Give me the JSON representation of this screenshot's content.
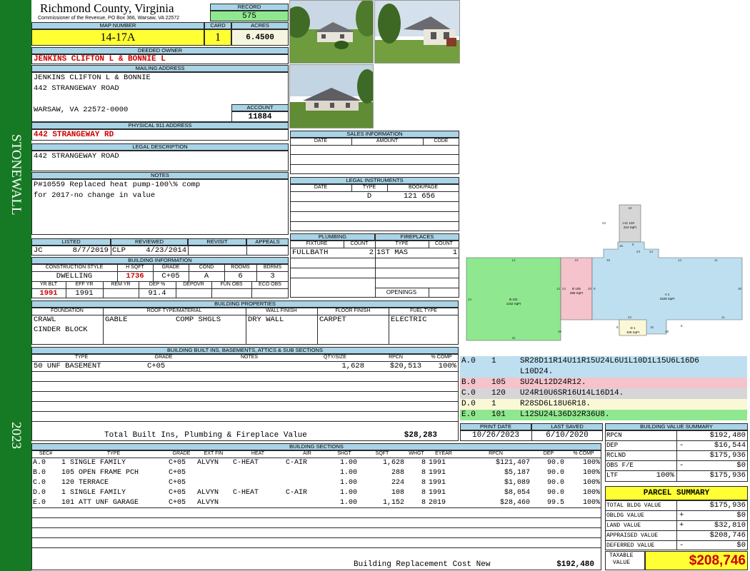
{
  "sidebar": {
    "district": "STONEWALL",
    "year": "2023"
  },
  "header": {
    "county": "Richmond County, Virginia",
    "commissioner": "Commissioner of the Revenue, PO Box 366, Warsaw, VA 22572"
  },
  "record": {
    "label": "RECORD",
    "value": "575"
  },
  "map": {
    "label": "MAP NUMBER",
    "value": "14-17A"
  },
  "card": {
    "label": "CARD",
    "value": "1"
  },
  "acres": {
    "label": "ACRES",
    "value": "6.4500"
  },
  "owner": {
    "label": "DEEDED OWNER",
    "value": "JENKINS CLIFTON L & BONNIE L"
  },
  "mailing": {
    "label": "MAILING ADDRESS",
    "line1": "JENKINS CLIFTON L & BONNIE",
    "line2": "442 STRANGEWAY ROAD",
    "line3": "WARSAW, VA 22572-0000"
  },
  "account": {
    "label": "ACCOUNT",
    "value": "11884"
  },
  "physical": {
    "label": "PHYSICAL 911 ADDRESS",
    "value": "442 STRANGEWAY RD"
  },
  "legal": {
    "label": "LEGAL DESCRIPTION",
    "value": "442 STRANGEWAY ROAD"
  },
  "notes": {
    "label": "NOTES",
    "line1": "P#10559 Replaced heat pump-100\\% comp",
    "line2": "for 2017-no change in value"
  },
  "sales": {
    "label": "SALES INFORMATION",
    "cols": [
      "DATE",
      "AMOUNT",
      "CODE"
    ]
  },
  "instruments": {
    "label": "LEGAL INSTRUMENTS",
    "cols": [
      "DATE",
      "TYPE",
      "BOOK/PAGE"
    ],
    "type": "D",
    "bookpage": "121 656"
  },
  "plumbing": {
    "label": "PLUMBING",
    "cols": [
      "FIXTURE",
      "COUNT"
    ],
    "fixture": "FULLBATH",
    "count": "2"
  },
  "fireplaces": {
    "label": "FIREPLACES",
    "cols": [
      "TYPE",
      "COUNT"
    ],
    "type": "1ST MAS",
    "count": "1",
    "openings": "OPENINGS"
  },
  "review": {
    "labels": [
      "LISTED",
      "REVIEWED",
      "REVISIT",
      "APPEALS"
    ],
    "listed_by": "JC",
    "listed_date": "8/7/2019",
    "reviewed_by": "CLP",
    "reviewed_date": "4/23/2014"
  },
  "building_info": {
    "label": "BUILDING INFORMATION",
    "cols1": [
      "CONSTRUCTION STYLE",
      "H SQFT",
      "GRADE",
      "COND",
      "ROOMS",
      "BDRMS"
    ],
    "style": "DWELLING",
    "hsqft": "1736",
    "grade": "C+05",
    "cond": "A",
    "rooms": "6",
    "bdrms": "3",
    "cols2": [
      "YR BLT",
      "EFF YR",
      "REM YR",
      "DEP %",
      "DEPOVR",
      "FUN OBS",
      "ECO OBS"
    ],
    "yrblt": "1991",
    "effyr": "1991",
    "dep": "91.4"
  },
  "properties": {
    "label": "BUILDING PROPERTIES",
    "cols": [
      "FOUNDATION",
      "ROOF TYPE/MATERIAL",
      "WALL FINISH",
      "FLOOR FINISH",
      "FUEL TYPE"
    ],
    "foundation1": "CRAWL",
    "foundation2": "CINDER BLOCK",
    "roof_type": "GABLE",
    "roof_material": "COMP SHGLS",
    "wall": "DRY WALL",
    "floor": "CARPET",
    "fuel": "ELECTRIC"
  },
  "builtins": {
    "label": "BUILDING BUILT INS, BASEMENTS, ATTICS & SUB SECTIONS",
    "cols": [
      "TYPE",
      "GRADE",
      "NOTES",
      "QTY/SIZE",
      "RPCN",
      "% COMP"
    ],
    "rows": [
      {
        "type": "50 UNF BASEMENT",
        "grade": "C+05",
        "notes": "",
        "qty": "1,628",
        "rpcn": "$20,513",
        "comp": "100%"
      }
    ],
    "total_label": "Total Built Ins, Plumbing & Fireplace Value",
    "total_value": "$28,283"
  },
  "sketch": {
    "areas": [
      {
        "label": "B 101",
        "sqft": "1152 SqFt"
      },
      {
        "label": "B 105",
        "sqft": "288 SqFt"
      },
      {
        "label": "A 1",
        "sqft": "1628 SqFt"
      },
      {
        "label": "C 120",
        "sqft": "224 SqFt"
      },
      {
        "label": "D 1",
        "sqft": "108 SqFt"
      }
    ],
    "dims": [
      "18",
      "14",
      "24",
      "12",
      "10",
      "15",
      "24",
      "14",
      "24",
      "12",
      "24",
      "20",
      "8",
      "36",
      "32",
      "36",
      "24",
      "14",
      "11",
      "11",
      "18",
      "6",
      "15",
      "8",
      "6",
      "16"
    ]
  },
  "codes": [
    {
      "sec": "A.0",
      "num": "1",
      "code": "SR28D11R14U11R15U24L6U1L10D1L15U6L16D6",
      "code2": "L10D24.",
      "color": "#bddff0"
    },
    {
      "sec": "B.0",
      "num": "105",
      "code": "SU24L12D24R12.",
      "color": "#f4c3cc"
    },
    {
      "sec": "C.0",
      "num": "120",
      "code": "U24R10U6SR16U14L16D14.",
      "color": "#d6d6d6"
    },
    {
      "sec": "D.0",
      "num": "1",
      "code": "R28SD6L18U6R18.",
      "color": "#fbf8d7"
    },
    {
      "sec": "E.0",
      "num": "101",
      "code": "L12SU24L36D32R36U8.",
      "color": "#8fe88f"
    }
  ],
  "print": {
    "label": "PRINT DATE",
    "value": "10/26/2023"
  },
  "saved": {
    "label": "LAST SAVED",
    "value": "6/10/2020"
  },
  "bv_summary": {
    "label": "BUILDING VALUE SUMMARY",
    "rows": [
      {
        "label": "RPCN",
        "sign": "",
        "value": "$192,480"
      },
      {
        "label": "DEP",
        "sign": "-",
        "value": "$16,544"
      },
      {
        "label": "RCLND",
        "sign": "",
        "value": "$175,936"
      },
      {
        "label": "OBS F/E",
        "sign": "-",
        "value": "$0"
      },
      {
        "label": "LTF",
        "pct": "100%",
        "sign": "",
        "value": "$175,936"
      }
    ]
  },
  "parcel": {
    "title": "PARCEL SUMMARY",
    "rows": [
      {
        "label": "TOTAL BLDG VALUE",
        "sign": "",
        "value": "$175,936"
      },
      {
        "label": "OBLDG VALUE",
        "sign": "+",
        "value": "$0"
      },
      {
        "label": "LAND VALUE",
        "sign": "+",
        "value": "$32,810"
      },
      {
        "label": "APPRAISED VALUE",
        "sign": "",
        "value": "$208,746"
      },
      {
        "label": "DEFERRED VALUE",
        "sign": "-",
        "value": "$0"
      }
    ],
    "taxable_label1": "TAXABLE",
    "taxable_label2": "VALUE",
    "taxable_value": "$208,746"
  },
  "sections": {
    "label": "BUILDING SECTIONS",
    "cols": [
      "SEC#",
      "TYPE",
      "GRADE",
      "EXT FIN",
      "HEAT",
      "AIR",
      "SHGT",
      "SQFT",
      "WHGT",
      "EYEAR",
      "RPCN",
      "DEP",
      "% COMP"
    ],
    "rows": [
      {
        "sec": "A.0",
        "type": "1 SINGLE FAMILY",
        "grade": "C+05",
        "ext": "ALVYN",
        "heat": "C-HEAT",
        "air": "C-AIR",
        "shgt": "1.00",
        "sqft": "1,628",
        "whgt": "8",
        "eyear": "1991",
        "rpcn": "$121,407",
        "dep": "90.0",
        "comp": "100%"
      },
      {
        "sec": "B.0",
        "type": "105 OPEN FRAME PCH",
        "grade": "C+05",
        "ext": "",
        "heat": "",
        "air": "",
        "shgt": "1.00",
        "sqft": "288",
        "whgt": "8",
        "eyear": "1991",
        "rpcn": "$5,187",
        "dep": "90.0",
        "comp": "100%"
      },
      {
        "sec": "C.0",
        "type": "120 TERRACE",
        "grade": "C+05",
        "ext": "",
        "heat": "",
        "air": "",
        "shgt": "1.00",
        "sqft": "224",
        "whgt": "8",
        "eyear": "1991",
        "rpcn": "$1,089",
        "dep": "90.0",
        "comp": "100%"
      },
      {
        "sec": "D.0",
        "type": "1 SINGLE FAMILY",
        "grade": "C+05",
        "ext": "ALVYN",
        "heat": "C-HEAT",
        "air": "C-AIR",
        "shgt": "1.00",
        "sqft": "108",
        "whgt": "8",
        "eyear": "1991",
        "rpcn": "$8,054",
        "dep": "90.0",
        "comp": "100%"
      },
      {
        "sec": "E.0",
        "type": "101 ATT UNF GARAGE",
        "grade": "C+05",
        "ext": "ALVYN",
        "heat": "",
        "air": "",
        "shgt": "1.00",
        "sqft": "1,152",
        "whgt": "8",
        "eyear": "2019",
        "rpcn": "$28,460",
        "dep": "99.5",
        "comp": "100%"
      }
    ],
    "total_label": "Building Replacement Cost New",
    "total_value": "$192,480"
  }
}
